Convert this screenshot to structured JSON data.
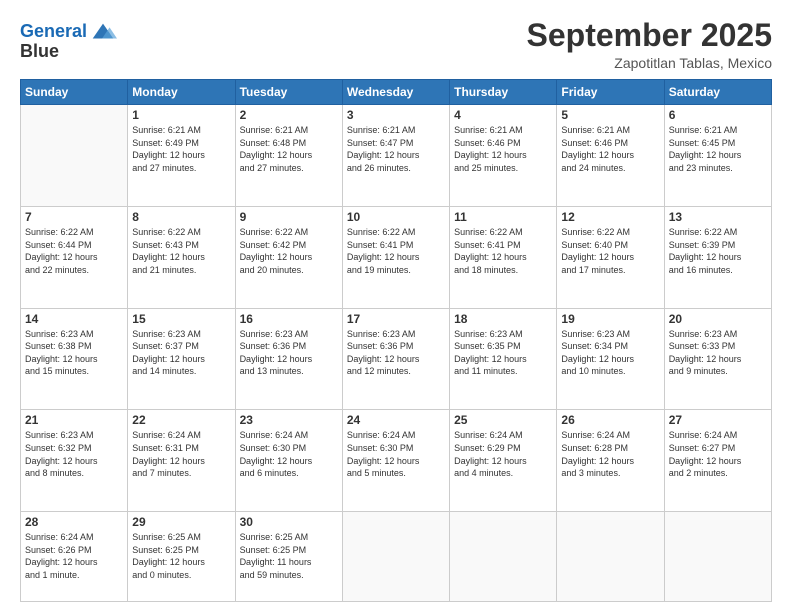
{
  "header": {
    "logo_line1": "General",
    "logo_line2": "Blue",
    "month_title": "September 2025",
    "location": "Zapotitlan Tablas, Mexico"
  },
  "days_of_week": [
    "Sunday",
    "Monday",
    "Tuesday",
    "Wednesday",
    "Thursday",
    "Friday",
    "Saturday"
  ],
  "weeks": [
    [
      {
        "day": "",
        "info": ""
      },
      {
        "day": "1",
        "info": "Sunrise: 6:21 AM\nSunset: 6:49 PM\nDaylight: 12 hours\nand 27 minutes."
      },
      {
        "day": "2",
        "info": "Sunrise: 6:21 AM\nSunset: 6:48 PM\nDaylight: 12 hours\nand 27 minutes."
      },
      {
        "day": "3",
        "info": "Sunrise: 6:21 AM\nSunset: 6:47 PM\nDaylight: 12 hours\nand 26 minutes."
      },
      {
        "day": "4",
        "info": "Sunrise: 6:21 AM\nSunset: 6:46 PM\nDaylight: 12 hours\nand 25 minutes."
      },
      {
        "day": "5",
        "info": "Sunrise: 6:21 AM\nSunset: 6:46 PM\nDaylight: 12 hours\nand 24 minutes."
      },
      {
        "day": "6",
        "info": "Sunrise: 6:21 AM\nSunset: 6:45 PM\nDaylight: 12 hours\nand 23 minutes."
      }
    ],
    [
      {
        "day": "7",
        "info": "Sunrise: 6:22 AM\nSunset: 6:44 PM\nDaylight: 12 hours\nand 22 minutes."
      },
      {
        "day": "8",
        "info": "Sunrise: 6:22 AM\nSunset: 6:43 PM\nDaylight: 12 hours\nand 21 minutes."
      },
      {
        "day": "9",
        "info": "Sunrise: 6:22 AM\nSunset: 6:42 PM\nDaylight: 12 hours\nand 20 minutes."
      },
      {
        "day": "10",
        "info": "Sunrise: 6:22 AM\nSunset: 6:41 PM\nDaylight: 12 hours\nand 19 minutes."
      },
      {
        "day": "11",
        "info": "Sunrise: 6:22 AM\nSunset: 6:41 PM\nDaylight: 12 hours\nand 18 minutes."
      },
      {
        "day": "12",
        "info": "Sunrise: 6:22 AM\nSunset: 6:40 PM\nDaylight: 12 hours\nand 17 minutes."
      },
      {
        "day": "13",
        "info": "Sunrise: 6:22 AM\nSunset: 6:39 PM\nDaylight: 12 hours\nand 16 minutes."
      }
    ],
    [
      {
        "day": "14",
        "info": "Sunrise: 6:23 AM\nSunset: 6:38 PM\nDaylight: 12 hours\nand 15 minutes."
      },
      {
        "day": "15",
        "info": "Sunrise: 6:23 AM\nSunset: 6:37 PM\nDaylight: 12 hours\nand 14 minutes."
      },
      {
        "day": "16",
        "info": "Sunrise: 6:23 AM\nSunset: 6:36 PM\nDaylight: 12 hours\nand 13 minutes."
      },
      {
        "day": "17",
        "info": "Sunrise: 6:23 AM\nSunset: 6:36 PM\nDaylight: 12 hours\nand 12 minutes."
      },
      {
        "day": "18",
        "info": "Sunrise: 6:23 AM\nSunset: 6:35 PM\nDaylight: 12 hours\nand 11 minutes."
      },
      {
        "day": "19",
        "info": "Sunrise: 6:23 AM\nSunset: 6:34 PM\nDaylight: 12 hours\nand 10 minutes."
      },
      {
        "day": "20",
        "info": "Sunrise: 6:23 AM\nSunset: 6:33 PM\nDaylight: 12 hours\nand 9 minutes."
      }
    ],
    [
      {
        "day": "21",
        "info": "Sunrise: 6:23 AM\nSunset: 6:32 PM\nDaylight: 12 hours\nand 8 minutes."
      },
      {
        "day": "22",
        "info": "Sunrise: 6:24 AM\nSunset: 6:31 PM\nDaylight: 12 hours\nand 7 minutes."
      },
      {
        "day": "23",
        "info": "Sunrise: 6:24 AM\nSunset: 6:30 PM\nDaylight: 12 hours\nand 6 minutes."
      },
      {
        "day": "24",
        "info": "Sunrise: 6:24 AM\nSunset: 6:30 PM\nDaylight: 12 hours\nand 5 minutes."
      },
      {
        "day": "25",
        "info": "Sunrise: 6:24 AM\nSunset: 6:29 PM\nDaylight: 12 hours\nand 4 minutes."
      },
      {
        "day": "26",
        "info": "Sunrise: 6:24 AM\nSunset: 6:28 PM\nDaylight: 12 hours\nand 3 minutes."
      },
      {
        "day": "27",
        "info": "Sunrise: 6:24 AM\nSunset: 6:27 PM\nDaylight: 12 hours\nand 2 minutes."
      }
    ],
    [
      {
        "day": "28",
        "info": "Sunrise: 6:24 AM\nSunset: 6:26 PM\nDaylight: 12 hours\nand 1 minute."
      },
      {
        "day": "29",
        "info": "Sunrise: 6:25 AM\nSunset: 6:25 PM\nDaylight: 12 hours\nand 0 minutes."
      },
      {
        "day": "30",
        "info": "Sunrise: 6:25 AM\nSunset: 6:25 PM\nDaylight: 11 hours\nand 59 minutes."
      },
      {
        "day": "",
        "info": ""
      },
      {
        "day": "",
        "info": ""
      },
      {
        "day": "",
        "info": ""
      },
      {
        "day": "",
        "info": ""
      }
    ]
  ]
}
